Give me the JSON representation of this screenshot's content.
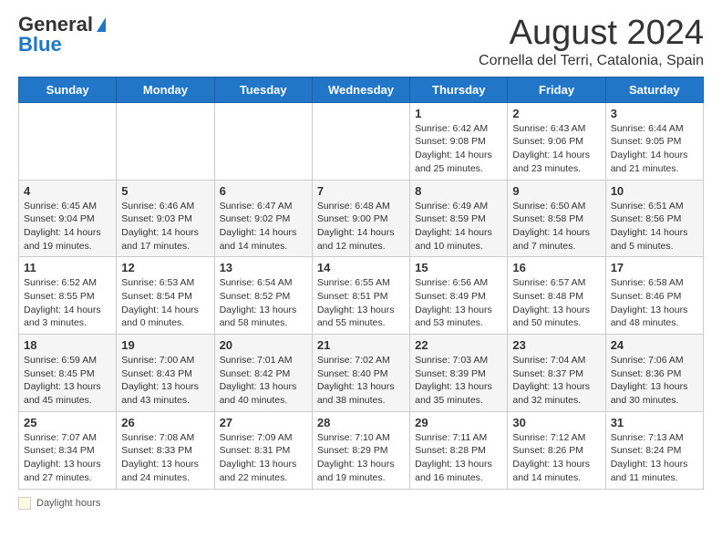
{
  "header": {
    "logo_general": "General",
    "logo_blue": "Blue",
    "title": "August 2024",
    "subtitle": "Cornella del Terri, Catalonia, Spain"
  },
  "weekdays": [
    "Sunday",
    "Monday",
    "Tuesday",
    "Wednesday",
    "Thursday",
    "Friday",
    "Saturday"
  ],
  "weeks": [
    [
      {
        "day": "",
        "content": ""
      },
      {
        "day": "",
        "content": ""
      },
      {
        "day": "",
        "content": ""
      },
      {
        "day": "",
        "content": ""
      },
      {
        "day": "1",
        "content": "Sunrise: 6:42 AM\nSunset: 9:08 PM\nDaylight: 14 hours and 25 minutes."
      },
      {
        "day": "2",
        "content": "Sunrise: 6:43 AM\nSunset: 9:06 PM\nDaylight: 14 hours and 23 minutes."
      },
      {
        "day": "3",
        "content": "Sunrise: 6:44 AM\nSunset: 9:05 PM\nDaylight: 14 hours and 21 minutes."
      }
    ],
    [
      {
        "day": "4",
        "content": "Sunrise: 6:45 AM\nSunset: 9:04 PM\nDaylight: 14 hours and 19 minutes."
      },
      {
        "day": "5",
        "content": "Sunrise: 6:46 AM\nSunset: 9:03 PM\nDaylight: 14 hours and 17 minutes."
      },
      {
        "day": "6",
        "content": "Sunrise: 6:47 AM\nSunset: 9:02 PM\nDaylight: 14 hours and 14 minutes."
      },
      {
        "day": "7",
        "content": "Sunrise: 6:48 AM\nSunset: 9:00 PM\nDaylight: 14 hours and 12 minutes."
      },
      {
        "day": "8",
        "content": "Sunrise: 6:49 AM\nSunset: 8:59 PM\nDaylight: 14 hours and 10 minutes."
      },
      {
        "day": "9",
        "content": "Sunrise: 6:50 AM\nSunset: 8:58 PM\nDaylight: 14 hours and 7 minutes."
      },
      {
        "day": "10",
        "content": "Sunrise: 6:51 AM\nSunset: 8:56 PM\nDaylight: 14 hours and 5 minutes."
      }
    ],
    [
      {
        "day": "11",
        "content": "Sunrise: 6:52 AM\nSunset: 8:55 PM\nDaylight: 14 hours and 3 minutes."
      },
      {
        "day": "12",
        "content": "Sunrise: 6:53 AM\nSunset: 8:54 PM\nDaylight: 14 hours and 0 minutes."
      },
      {
        "day": "13",
        "content": "Sunrise: 6:54 AM\nSunset: 8:52 PM\nDaylight: 13 hours and 58 minutes."
      },
      {
        "day": "14",
        "content": "Sunrise: 6:55 AM\nSunset: 8:51 PM\nDaylight: 13 hours and 55 minutes."
      },
      {
        "day": "15",
        "content": "Sunrise: 6:56 AM\nSunset: 8:49 PM\nDaylight: 13 hours and 53 minutes."
      },
      {
        "day": "16",
        "content": "Sunrise: 6:57 AM\nSunset: 8:48 PM\nDaylight: 13 hours and 50 minutes."
      },
      {
        "day": "17",
        "content": "Sunrise: 6:58 AM\nSunset: 8:46 PM\nDaylight: 13 hours and 48 minutes."
      }
    ],
    [
      {
        "day": "18",
        "content": "Sunrise: 6:59 AM\nSunset: 8:45 PM\nDaylight: 13 hours and 45 minutes."
      },
      {
        "day": "19",
        "content": "Sunrise: 7:00 AM\nSunset: 8:43 PM\nDaylight: 13 hours and 43 minutes."
      },
      {
        "day": "20",
        "content": "Sunrise: 7:01 AM\nSunset: 8:42 PM\nDaylight: 13 hours and 40 minutes."
      },
      {
        "day": "21",
        "content": "Sunrise: 7:02 AM\nSunset: 8:40 PM\nDaylight: 13 hours and 38 minutes."
      },
      {
        "day": "22",
        "content": "Sunrise: 7:03 AM\nSunset: 8:39 PM\nDaylight: 13 hours and 35 minutes."
      },
      {
        "day": "23",
        "content": "Sunrise: 7:04 AM\nSunset: 8:37 PM\nDaylight: 13 hours and 32 minutes."
      },
      {
        "day": "24",
        "content": "Sunrise: 7:06 AM\nSunset: 8:36 PM\nDaylight: 13 hours and 30 minutes."
      }
    ],
    [
      {
        "day": "25",
        "content": "Sunrise: 7:07 AM\nSunset: 8:34 PM\nDaylight: 13 hours and 27 minutes."
      },
      {
        "day": "26",
        "content": "Sunrise: 7:08 AM\nSunset: 8:33 PM\nDaylight: 13 hours and 24 minutes."
      },
      {
        "day": "27",
        "content": "Sunrise: 7:09 AM\nSunset: 8:31 PM\nDaylight: 13 hours and 22 minutes."
      },
      {
        "day": "28",
        "content": "Sunrise: 7:10 AM\nSunset: 8:29 PM\nDaylight: 13 hours and 19 minutes."
      },
      {
        "day": "29",
        "content": "Sunrise: 7:11 AM\nSunset: 8:28 PM\nDaylight: 13 hours and 16 minutes."
      },
      {
        "day": "30",
        "content": "Sunrise: 7:12 AM\nSunset: 8:26 PM\nDaylight: 13 hours and 14 minutes."
      },
      {
        "day": "31",
        "content": "Sunrise: 7:13 AM\nSunset: 8:24 PM\nDaylight: 13 hours and 11 minutes."
      }
    ]
  ],
  "footer": {
    "daylight_label": "Daylight hours"
  }
}
